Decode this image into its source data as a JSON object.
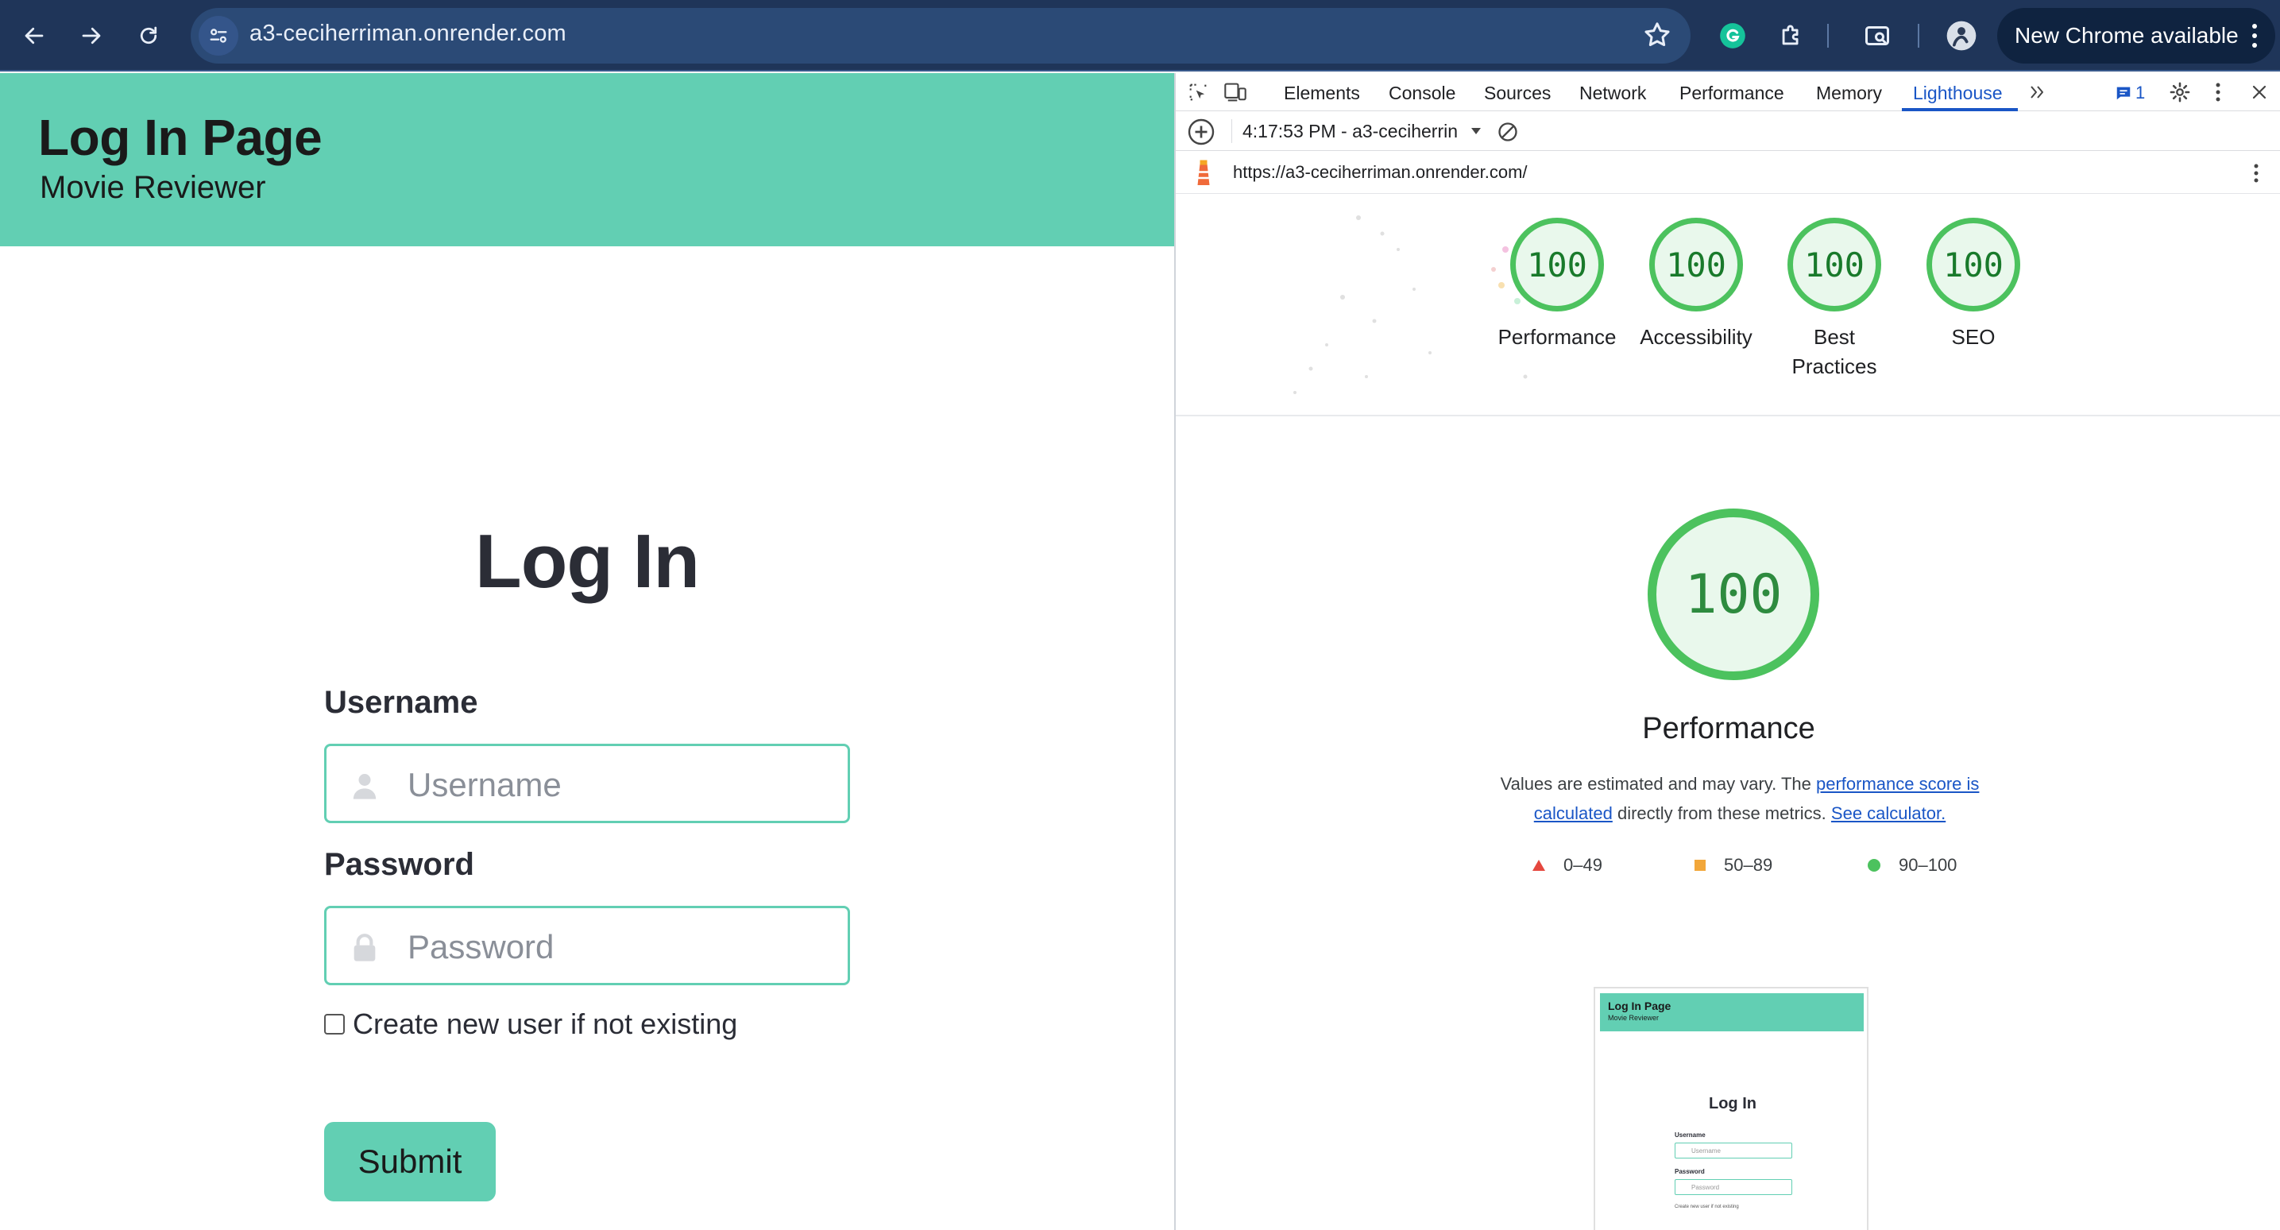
{
  "browser": {
    "url": "a3-ceciherriman.onrender.com",
    "update_label": "New Chrome available"
  },
  "page": {
    "header": {
      "title": "Log In Page",
      "subtitle": "Movie Reviewer"
    },
    "form": {
      "heading": "Log In",
      "username_label": "Username",
      "username_placeholder": "Username",
      "password_label": "Password",
      "password_placeholder": "Password",
      "checkbox_label": "Create new user if not existing",
      "checkbox_checked": false,
      "submit_label": "Submit"
    },
    "accent_color": "#62cfb3"
  },
  "devtools": {
    "tabs": [
      "Elements",
      "Console",
      "Sources",
      "Network",
      "Performance",
      "Memory",
      "Lighthouse"
    ],
    "active_tab": "Lighthouse",
    "issues_count": "1",
    "report_selector": "4:17:53 PM - a3-ceciherrin",
    "report_url": "https://a3-ceciherriman.onrender.com/",
    "scores": [
      {
        "label": "Performance",
        "value": "100"
      },
      {
        "label": "Accessibility",
        "value": "100"
      },
      {
        "label": "Best Practices",
        "value": "100"
      },
      {
        "label": "SEO",
        "value": "100"
      }
    ],
    "main_score": {
      "value": "100",
      "title": "Performance"
    },
    "description": {
      "prefix": "Values are estimated and may vary. The ",
      "link1": "performance score is calculated",
      "middle": " directly from these metrics. ",
      "link2": "See calculator."
    },
    "legend": [
      {
        "range": "0–49",
        "color": "#e5483f",
        "shape": "triangle"
      },
      {
        "range": "50–89",
        "color": "#f2a73a",
        "shape": "square"
      },
      {
        "range": "90–100",
        "color": "#4cc25e",
        "shape": "circle"
      }
    ],
    "score_color": "#4cc25e",
    "thumbnail": {
      "title": "Log In Page",
      "subtitle": "Movie Reviewer",
      "heading": "Log In",
      "username_label": "Username",
      "username_placeholder": "Username",
      "password_label": "Password",
      "password_placeholder": "Password",
      "checkbox_label": "Create new user if not existing"
    }
  }
}
